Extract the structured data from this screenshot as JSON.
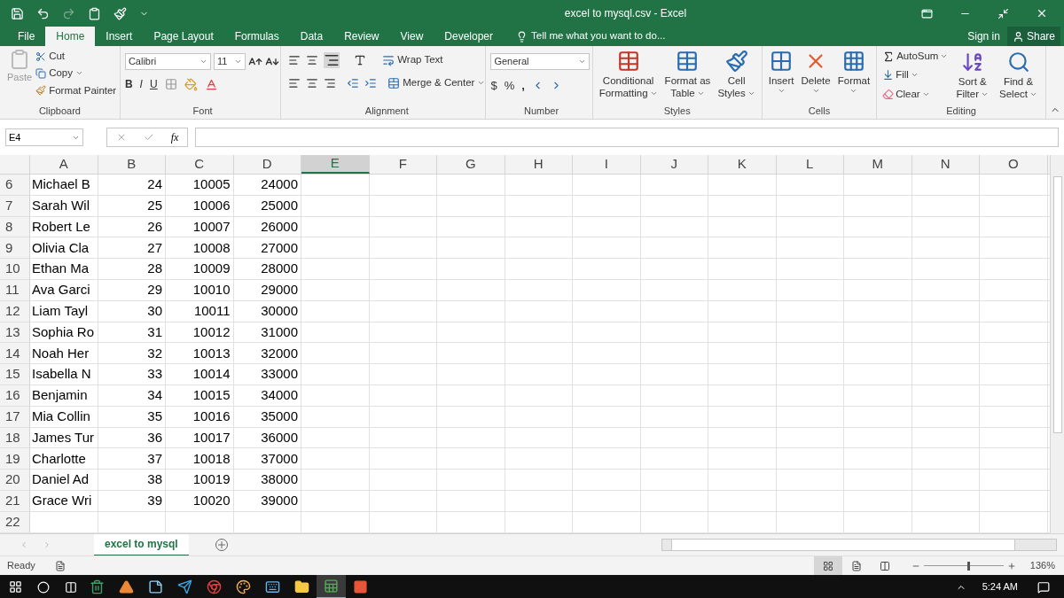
{
  "window": {
    "title": "excel to mysql.csv - Excel"
  },
  "tabs": [
    {
      "label": "File",
      "selected": false
    },
    {
      "label": "Home",
      "selected": true
    },
    {
      "label": "Insert",
      "selected": false
    },
    {
      "label": "Page Layout",
      "selected": false
    },
    {
      "label": "Formulas",
      "selected": false
    },
    {
      "label": "Data",
      "selected": false
    },
    {
      "label": "Review",
      "selected": false
    },
    {
      "label": "View",
      "selected": false
    },
    {
      "label": "Developer",
      "selected": false
    }
  ],
  "tell_me": {
    "placeholder": "Tell me what you want to do..."
  },
  "account": {
    "sign_in": "Sign in",
    "share": "Share"
  },
  "ribbon": {
    "clipboard": {
      "label": "Clipboard",
      "paste": "Paste",
      "cut": "Cut",
      "copy": "Copy",
      "format_painter": "Format Painter"
    },
    "font": {
      "label": "Font",
      "family": "Calibri",
      "size": "11",
      "bold": "B",
      "italic": "I",
      "underline": "U"
    },
    "alignment": {
      "label": "Alignment",
      "wrap_text": "Wrap Text",
      "merge_center": "Merge & Center"
    },
    "number": {
      "label": "Number",
      "format": "General",
      "currency": "$",
      "percent": "%",
      "comma": ","
    },
    "styles": {
      "label": "Styles",
      "buttons": [
        {
          "kind": "conditional",
          "line1": "Conditional",
          "line2": "Formatting"
        },
        {
          "kind": "table",
          "line1": "Format as",
          "line2": "Table"
        },
        {
          "kind": "cell",
          "line1": "Cell",
          "line2": "Styles"
        }
      ]
    },
    "cells": {
      "label": "Cells",
      "buttons": [
        {
          "kind": "insert",
          "line1": "Insert"
        },
        {
          "kind": "delete",
          "line1": "Delete"
        },
        {
          "kind": "format",
          "line1": "Format"
        }
      ]
    },
    "editing": {
      "label": "Editing",
      "autosum": "AutoSum",
      "fill": "Fill",
      "clear": "Clear",
      "buttons": [
        {
          "kind": "sort",
          "line1": "Sort &",
          "line2": "Filter"
        },
        {
          "kind": "find",
          "line1": "Find &",
          "line2": "Select"
        }
      ]
    }
  },
  "formula_bar": {
    "name_box": "E4",
    "fx": "fx"
  },
  "columns": [
    {
      "label": "A",
      "selected": false
    },
    {
      "label": "B",
      "selected": false
    },
    {
      "label": "C",
      "selected": false
    },
    {
      "label": "D",
      "selected": false
    },
    {
      "label": "E",
      "selected": true
    },
    {
      "label": "F",
      "selected": false
    },
    {
      "label": "G",
      "selected": false
    },
    {
      "label": "H",
      "selected": false
    },
    {
      "label": "I",
      "selected": false
    },
    {
      "label": "J",
      "selected": false
    },
    {
      "label": "K",
      "selected": false
    },
    {
      "label": "L",
      "selected": false
    },
    {
      "label": "M",
      "selected": false
    },
    {
      "label": "N",
      "selected": false
    },
    {
      "label": "O",
      "selected": false
    }
  ],
  "rows": [
    {
      "number": "6",
      "cells": [
        "Michael B",
        "24",
        "10005",
        "24000"
      ]
    },
    {
      "number": "7",
      "cells": [
        "Sarah Wil",
        "25",
        "10006",
        "25000"
      ]
    },
    {
      "number": "8",
      "cells": [
        "Robert Le",
        "26",
        "10007",
        "26000"
      ]
    },
    {
      "number": "9",
      "cells": [
        "Olivia Cla",
        "27",
        "10008",
        "27000"
      ]
    },
    {
      "number": "10",
      "cells": [
        "Ethan Ma",
        "28",
        "10009",
        "28000"
      ]
    },
    {
      "number": "11",
      "cells": [
        "Ava Garci",
        "29",
        "10010",
        "29000"
      ]
    },
    {
      "number": "12",
      "cells": [
        "Liam Tayl",
        "30",
        "10011",
        "30000"
      ]
    },
    {
      "number": "13",
      "cells": [
        "Sophia Ro",
        "31",
        "10012",
        "31000"
      ]
    },
    {
      "number": "14",
      "cells": [
        "Noah Her",
        "32",
        "10013",
        "32000"
      ]
    },
    {
      "number": "15",
      "cells": [
        "Isabella N",
        "33",
        "10014",
        "33000"
      ]
    },
    {
      "number": "16",
      "cells": [
        "Benjamin",
        "34",
        "10015",
        "34000"
      ]
    },
    {
      "number": "17",
      "cells": [
        "Mia Collin",
        "35",
        "10016",
        "35000"
      ]
    },
    {
      "number": "18",
      "cells": [
        "James Tur",
        "36",
        "10017",
        "36000"
      ]
    },
    {
      "number": "19",
      "cells": [
        "Charlotte",
        "37",
        "10018",
        "37000"
      ]
    },
    {
      "number": "20",
      "cells": [
        "Daniel Ad",
        "38",
        "10019",
        "38000"
      ]
    },
    {
      "number": "21",
      "cells": [
        "Grace Wri",
        "39",
        "10020",
        "39000"
      ]
    },
    {
      "number": "22",
      "cells": []
    }
  ],
  "sheet_tabs": [
    {
      "label": "excel to mysql",
      "selected": true
    }
  ],
  "status_bar": {
    "status": "Ready",
    "views": [
      {
        "kind": "normal",
        "selected": true
      },
      {
        "kind": "layout",
        "selected": false
      },
      {
        "kind": "break",
        "selected": false
      }
    ],
    "zoom": {
      "level": 0.57,
      "reading": "136%"
    }
  },
  "taskbar": {
    "apps": [
      {
        "kind": "can",
        "active": false
      },
      {
        "kind": "cone",
        "active": false
      },
      {
        "kind": "notepad",
        "active": false
      },
      {
        "kind": "telegram",
        "active": false
      },
      {
        "kind": "chrome",
        "active": false
      },
      {
        "kind": "paint",
        "active": false
      },
      {
        "kind": "keyboard",
        "active": false
      },
      {
        "kind": "folder",
        "active": false
      },
      {
        "kind": "excel",
        "active": true
      },
      {
        "kind": "red",
        "active": false
      }
    ],
    "time": "5:24 AM"
  }
}
